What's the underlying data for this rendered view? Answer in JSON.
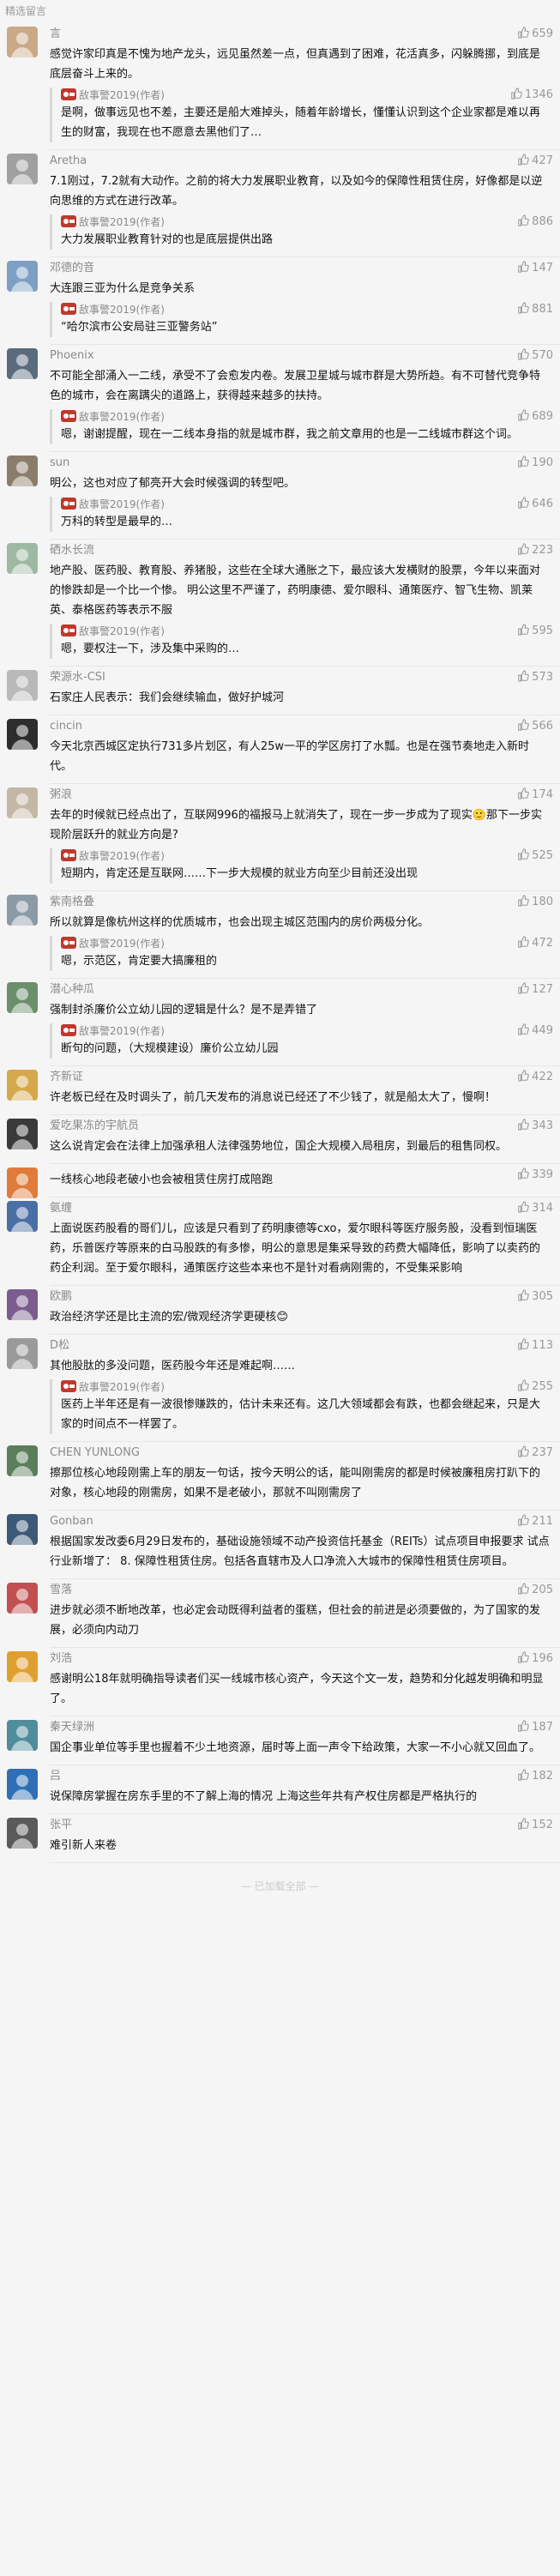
{
  "section_title": "精选留言",
  "author_name": "敌事警2019(作者)",
  "comments": [
    {
      "nick": "言",
      "likes": "659",
      "text": "感觉许家印真是不愧为地产龙头，远见虽然差一点，但真遇到了困难，花活真多，闪躲腾挪，到底是底层奋斗上来的。",
      "replies": [
        {
          "text": "是啊，做事远见也不差，主要还是船大难掉头，随着年龄增长，懂懂认识到这个企业家都是难以再生的财富，我现在也不愿意去黑他们了…",
          "likes": "1346"
        }
      ],
      "color": "#c9a987"
    },
    {
      "nick": "Aretha",
      "likes": "427",
      "text": "7.1刚过，7.2就有大动作。之前的将大力发展职业教育，以及如今的保障性租赁住房，好像都是以逆向思维的方式在进行改革。",
      "replies": [
        {
          "text": "大力发展职业教育针对的也是底层提供出路",
          "likes": "886"
        }
      ],
      "color": "#a0a0a0"
    },
    {
      "nick": "邓德的音",
      "likes": "147",
      "text": "大连跟三亚为什么是竞争关系",
      "replies": [
        {
          "text": "“哈尔滨市公安局驻三亚警务站”",
          "likes": "881"
        }
      ],
      "color": "#7d9fc4"
    },
    {
      "nick": "Phoenix",
      "likes": "570",
      "text": "不可能全部涌入一二线，承受不了会愈发内卷。发展卫星城与城市群是大势所趋。有不可替代竞争特色的城市，会在离蹒尖的道路上，获得越来越多的扶持。",
      "replies": [
        {
          "text": "嗯，谢谢提醒，现在一二线本身指的就是城市群，我之前文章用的也是一二线城市群这个词。",
          "likes": "689"
        }
      ],
      "color": "#5a6b7c"
    },
    {
      "nick": "sun",
      "likes": "190",
      "text": "明公，这也对应了郁亮开大会时候强调的转型吧。",
      "replies": [
        {
          "text": "万科的转型是最早的…",
          "likes": "646"
        }
      ],
      "color": "#8b7d6b"
    },
    {
      "nick": "硒水长流",
      "likes": "223",
      "text": "地产股、医药股、教育股、养猪股，这些在全球大通胀之下，最应该大发横财的股票，今年以来面对的惨跌却是一个比一个惨。 明公这里不严谨了，药明康德、爱尔眼科、通策医疗、智飞生物、凯莱英、泰格医药等表示不服",
      "replies": [
        {
          "text": "嗯，要权注一下，涉及集中采购的…",
          "likes": "595"
        }
      ],
      "color": "#9fb8a4"
    },
    {
      "nick": "荣源水-CSI",
      "likes": "573",
      "text": "石家庄人民表示：我们会继续输血，做好护城河",
      "replies": [],
      "color": "#b9b9b9"
    },
    {
      "nick": "cincin",
      "likes": "566",
      "text": "今天北京西城区定执行731多片划区，有人25w一平的学区房打了水瓢。也是在强节奏地走入新时代。",
      "replies": [],
      "color": "#2d2d2d"
    },
    {
      "nick": "粥浪",
      "likes": "174",
      "text": "去年的时候就已经点出了，互联网996的福报马上就消失了，现在一步一步成为了现实🙂那下一步实现阶层跃升的就业方向是?",
      "replies": [
        {
          "text": "短期内，肯定还是互联网……下一步大规模的就业方向至少目前还没出现",
          "likes": "525"
        }
      ],
      "color": "#c4b7a6"
    },
    {
      "nick": "紫南格叠",
      "likes": "180",
      "text": "所以就算是像杭州这样的优质城市，也会出现主城区范围内的房价两极分化。",
      "replies": [
        {
          "text": "嗯，示范区，肯定要大搞廉租的",
          "likes": "472"
        }
      ],
      "color": "#8c9aa6"
    },
    {
      "nick": "潜心种瓜",
      "likes": "127",
      "text": "强制封杀廉价公立幼儿园的逻辑是什么？是不是弄错了",
      "replies": [
        {
          "text": "断句的问题，（大规模建设）廉价公立幼儿园",
          "likes": "449"
        }
      ],
      "color": "#6b8e6b"
    },
    {
      "nick": "齐新证",
      "likes": "422",
      "text": "许老板已经在及时调头了，前几天发布的消息说已经还了不少钱了，就是船太大了，慢啊！",
      "replies": [],
      "color": "#d4a84b"
    },
    {
      "nick": "爱吃果冻的宇航员",
      "likes": "343",
      "text": "这么说肯定会在法律上加强承租人法律强势地位，国企大规模入局租房，到最后的租售同权。",
      "replies": [],
      "color": "#3a3a3a"
    },
    {
      "nick": "",
      "likes": "339",
      "text": "一线核心地段老破小也会被租赁住房打成陪跑",
      "replies": [],
      "color": "#e07b3a"
    },
    {
      "nick": "氨缠",
      "likes": "314",
      "text": "上面说医药股看的哥们儿，应该是只看到了药明康德等cxo，爱尔眼科等医疗服务股，没看到恒瑞医药，乐普医疗等原来的白马股跌的有多惨，明公的意思是集采导致的药费大幅降低，影响了以卖药的药企利润。至于爱尔眼科，通策医疗这些本来也不是针对看病刚需的，不受集采影响",
      "replies": [],
      "color": "#4a6fa5"
    },
    {
      "nick": "欧鹏",
      "likes": "305",
      "text": "政治经济学还是比主流的宏/微观经济学更硬核😊",
      "replies": [],
      "color": "#7a5c8f"
    },
    {
      "nick": "D松",
      "likes": "113",
      "text": "其他股肽的多没问题，医药股今年还是难起啊……",
      "replies": [
        {
          "text": "医药上半年还是有一波很惨赚跌的，估计未来还有。这几大领域都会有跌，也都会继起来，只是大家的时间点不一样罢了。",
          "likes": "255"
        }
      ],
      "color": "#9a9a9a"
    },
    {
      "nick": "CHEN YUNLONG",
      "likes": "237",
      "text": "擦那位核心地段刚需上车的朋友一句话，按今天明公的话，能叫刚需房的都是时候被廉租房打趴下的对象，核心地段的刚需房，如果不是老破小，那就不叫刚需房了",
      "replies": [],
      "color": "#5b7f5b"
    },
    {
      "nick": "Gonban",
      "likes": "211",
      "text": "根据国家发改委6月29日发布的，基础设施领域不动产投资信托基金（REITs）试点项目申报要求 试点行业新增了： 8. 保障性租赁住房。包括各直辖市及人口净流入大城市的保障性租赁住房项目。",
      "replies": [],
      "color": "#3c5a78"
    },
    {
      "nick": "雪落",
      "likes": "205",
      "text": "进步就必须不断地改革，也必定会动既得利益者的蛋糕，但社会的前进是必须要做的，为了国家的发展，必须向内动刀",
      "replies": [],
      "color": "#c25050"
    },
    {
      "nick": "刘浩",
      "likes": "196",
      "text": "感谢明公18年就明确指导读者们买一线城市核心资产，今天这个文一发，趋势和分化越发明确和明显了。",
      "replies": [],
      "color": "#e0a030"
    },
    {
      "nick": "秦天绿洲",
      "likes": "187",
      "text": "国企事业单位等手里也握着不少土地资源，届时等上面一声令下给政策，大家一不小心就又回血了。",
      "replies": [],
      "color": "#4f8c9c"
    },
    {
      "nick": "吕",
      "likes": "182",
      "text": "说保障房掌握在房东手里的不了解上海的情况 上海这些年共有产权住房都是严格执行的",
      "replies": [],
      "color": "#2f6fb5"
    },
    {
      "nick": "张平",
      "likes": "152",
      "text": "难引新人来卷",
      "replies": [],
      "color": "#5a5a5a"
    }
  ],
  "footer_text": "— 已加载全部 —"
}
